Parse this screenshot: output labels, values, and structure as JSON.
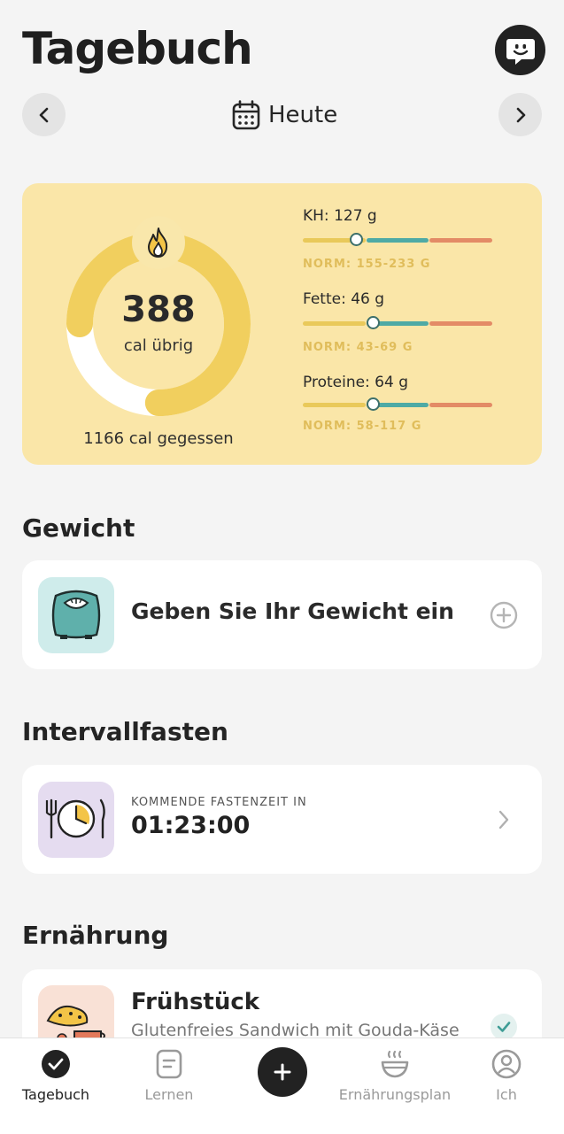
{
  "header": {
    "title": "Tagebuch",
    "date_label": "Heute"
  },
  "summary": {
    "remaining_value": "388",
    "remaining_label": "cal übrig",
    "eaten_label": "1166 cal gegessen",
    "ring_fraction": 0.75,
    "macros": [
      {
        "label": "KH: 127 g",
        "norm": "NORM: 155-233 G",
        "level": 0.28
      },
      {
        "label": "Fette: 46 g",
        "norm": "NORM: 43-69 G",
        "level": 0.37
      },
      {
        "label": "Proteine: 64 g",
        "norm": "NORM: 58-117 G",
        "level": 0.37
      }
    ]
  },
  "weight": {
    "section_title": "Gewicht",
    "card_text": "Geben Sie Ihr Gewicht ein"
  },
  "fasting": {
    "section_title": "Intervallfasten",
    "label": "KOMMENDE FASTENZEIT IN",
    "time": "01:23:00"
  },
  "nutrition": {
    "section_title": "Ernährung",
    "meal_title": "Frühstück",
    "meal_desc": "Glutenfreies Sandwich mit Gouda-Käse"
  },
  "tabs": [
    {
      "label": "Tagebuch",
      "icon": "check-circle-icon",
      "active": true
    },
    {
      "label": "Lernen",
      "icon": "document-icon",
      "active": false
    },
    {
      "label": "",
      "icon": "plus-icon",
      "active": false
    },
    {
      "label": "Ernährungsplan",
      "icon": "bowl-icon",
      "active": false
    },
    {
      "label": "Ich",
      "icon": "profile-icon",
      "active": false
    }
  ],
  "colors": {
    "summary_bg": "#fae6a8",
    "ring_yellow": "#f1cf5e",
    "bar_yellow": "#e9c95a",
    "bar_teal": "#4eaaa5",
    "bar_coral": "#e38b66",
    "weight_tile": "#cfeceb",
    "fasting_tile": "#e5dcf0",
    "meal_tile": "#f9e1d6"
  }
}
